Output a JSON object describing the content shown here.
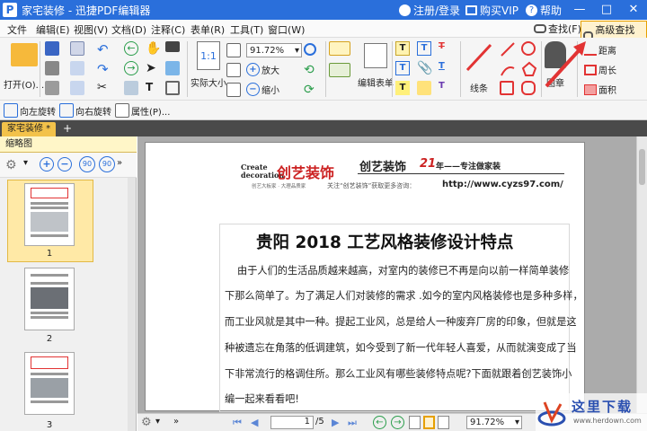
{
  "app": {
    "title": "家宅装修 - 迅捷PDF编辑器",
    "login": "注册/登录",
    "vip": "购买VIP",
    "help": "帮助"
  },
  "menu": {
    "items": [
      "文件",
      "编辑(E)",
      "视图(V)",
      "文档(D)",
      "注释(C)",
      "表单(R)",
      "工具(T)",
      "窗口(W)"
    ],
    "search": "查找(F)",
    "advanced_search": "高级查找(S)"
  },
  "ribbon": {
    "open": "打开(O)...",
    "zoom_value": "91.72%",
    "zoom_in": "放大",
    "zoom_out": "缩小",
    "actual_size": "实际大小",
    "edit_form": "编辑表单",
    "line": "线条",
    "stamp": "图章",
    "distance": "距离",
    "perimeter": "周长",
    "area": "面积"
  },
  "toolbar2": {
    "rotate_left": "向左旋转",
    "rotate_right": "向右旋转",
    "properties": "属性(P)..."
  },
  "tab": {
    "label": "家宅装修 *",
    "add": "+"
  },
  "sidebar": {
    "title": "缩略图",
    "pages": [
      "1",
      "2",
      "3"
    ]
  },
  "page": {
    "logo_top": "Create",
    "logo_mid": "decoration",
    "logo_cn": "创艺装饰",
    "logo_sub": "创艺大板家 · 大理品质家",
    "brand_line_a": "创艺装饰",
    "brand_line_b": "21",
    "brand_line_c": "年——专注做家装",
    "follow_text": "关注“创艺装饰”获取更多咨询：",
    "url": "http://www.cyzs97.com/",
    "heading": "贵阳 2018 工艺风格装修设计特点",
    "lines": [
      "由于人们的生活品质越来越高，对室内的装修已不再是向以前一样简单装修",
      "下那么简单了。为了满足人们对装修的需求 .如今的室内风格装修也是多种多样，",
      "而工业风就是其中一种。提起工业风，总是给人一种废弃厂房的印象，但就是这",
      "种被遗忘在角落的低调建筑，如今受到了新一代年轻人喜爱，从而就演变成了当",
      "下非常流行的格调住所。那么工业风有哪些装修特点呢?下面就跟着创艺装饰小",
      "编一起来看看吧!"
    ]
  },
  "status": {
    "page_field": "1",
    "page_total": "/5",
    "zoom": "91.72%"
  },
  "watermark": {
    "cn": "这里下载",
    "url": "www.herdown.com"
  },
  "colors": {
    "titlebar": "#2a6fdb",
    "accent_red": "#e23333",
    "tab": "#f3c24a"
  }
}
